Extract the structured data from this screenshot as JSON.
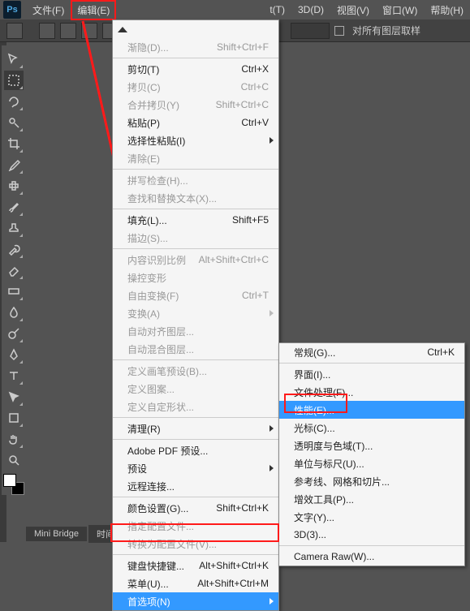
{
  "menubar": {
    "logo": "Ps",
    "items": [
      "文件(F)",
      "编辑(E)"
    ],
    "right_items": [
      "t(T)",
      "3D(D)",
      "视图(V)",
      "窗口(W)",
      "帮助(H)"
    ]
  },
  "options": {
    "sample_label": "对所有图层取样"
  },
  "edit_menu": [
    {
      "label": "",
      "up": true
    },
    {
      "label": "渐隐(D)...",
      "short": "Shift+Ctrl+F",
      "disabled": true,
      "sep": true
    },
    {
      "label": "剪切(T)",
      "short": "Ctrl+X"
    },
    {
      "label": "拷贝(C)",
      "short": "Ctrl+C",
      "disabled": true
    },
    {
      "label": "合并拷贝(Y)",
      "short": "Shift+Ctrl+C",
      "disabled": true
    },
    {
      "label": "粘贴(P)",
      "short": "Ctrl+V"
    },
    {
      "label": "选择性粘贴(I)",
      "arrow": true
    },
    {
      "label": "清除(E)",
      "sep": true,
      "disabled": true
    },
    {
      "label": "拼写检查(H)...",
      "disabled": true
    },
    {
      "label": "查找和替换文本(X)...",
      "sep": true,
      "disabled": true
    },
    {
      "label": "填充(L)...",
      "short": "Shift+F5"
    },
    {
      "label": "描边(S)...",
      "sep": true,
      "disabled": true
    },
    {
      "label": "内容识别比例",
      "short": "Alt+Shift+Ctrl+C",
      "disabled": true
    },
    {
      "label": "操控变形",
      "disabled": true
    },
    {
      "label": "自由变换(F)",
      "short": "Ctrl+T",
      "disabled": true
    },
    {
      "label": "变换(A)",
      "arrow": true,
      "disabled": true
    },
    {
      "label": "自动对齐图层...",
      "disabled": true
    },
    {
      "label": "自动混合图层...",
      "sep": true,
      "disabled": true
    },
    {
      "label": "定义画笔预设(B)...",
      "disabled": true
    },
    {
      "label": "定义图案...",
      "disabled": true
    },
    {
      "label": "定义自定形状...",
      "sep": true,
      "disabled": true
    },
    {
      "label": "清理(R)",
      "arrow": true,
      "sep": true
    },
    {
      "label": "Adobe PDF 预设..."
    },
    {
      "label": "预设",
      "arrow": true
    },
    {
      "label": "远程连接...",
      "sep": true
    },
    {
      "label": "颜色设置(G)...",
      "short": "Shift+Ctrl+K"
    },
    {
      "label": "指定配置文件...",
      "disabled": true
    },
    {
      "label": "转换为配置文件(V)...",
      "sep": true,
      "disabled": true
    },
    {
      "label": "键盘快捷键...",
      "short": "Alt+Shift+Ctrl+K"
    },
    {
      "label": "菜单(U)...",
      "short": "Alt+Shift+Ctrl+M"
    },
    {
      "label": "首选项(N)",
      "arrow": true,
      "selected": true
    }
  ],
  "prefs_submenu": [
    {
      "label": "常规(G)...",
      "short": "Ctrl+K",
      "sep": true
    },
    {
      "label": "界面(I)..."
    },
    {
      "label": "文件处理(F)..."
    },
    {
      "label": "性能(E)...",
      "selected": true
    },
    {
      "label": "光标(C)..."
    },
    {
      "label": "透明度与色域(T)..."
    },
    {
      "label": "单位与标尺(U)..."
    },
    {
      "label": "参考线、网格和切片..."
    },
    {
      "label": "增效工具(P)..."
    },
    {
      "label": "文字(Y)..."
    },
    {
      "label": "3D(3)...",
      "sep": true
    },
    {
      "label": "Camera Raw(W)..."
    }
  ],
  "tabs": [
    "Mini Bridge",
    "时间轴"
  ]
}
